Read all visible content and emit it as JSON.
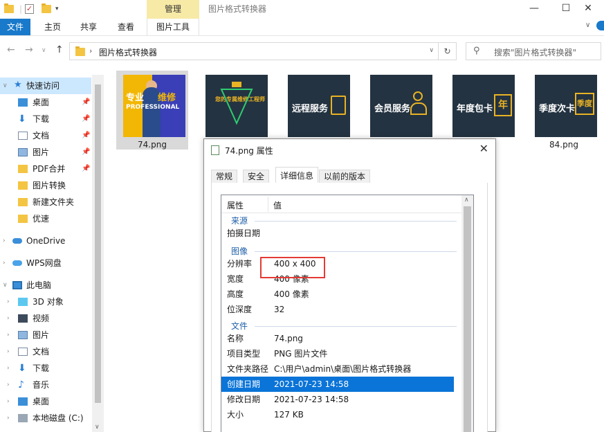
{
  "window": {
    "title": "图片格式转换器",
    "contextual_tab": "管理",
    "controls": {
      "minimize": "—",
      "maximize": "☐",
      "close": "✕"
    }
  },
  "ribbon": {
    "tabs": [
      "文件",
      "主页",
      "共享",
      "查看",
      "图片工具"
    ]
  },
  "address": {
    "path": "图片格式转换器",
    "search_placeholder": "搜索\"图片格式转换器\""
  },
  "sidebar": {
    "items": [
      {
        "label": "快速访问",
        "icon": "star-icon",
        "pinned": false
      },
      {
        "label": "桌面",
        "icon": "desktop-icon",
        "pinned": true
      },
      {
        "label": "下载",
        "icon": "download-icon",
        "pinned": true
      },
      {
        "label": "文档",
        "icon": "document-icon",
        "pinned": true
      },
      {
        "label": "图片",
        "icon": "pictures-icon",
        "pinned": true
      },
      {
        "label": "PDF合并",
        "icon": "folder-icon",
        "pinned": true
      },
      {
        "label": "图片转换",
        "icon": "folder-icon",
        "pinned": false
      },
      {
        "label": "新建文件夹",
        "icon": "folder-icon",
        "pinned": false
      },
      {
        "label": "优速",
        "icon": "folder-icon",
        "pinned": false
      },
      {
        "label": "OneDrive",
        "icon": "onedrive-icon",
        "pinned": false
      },
      {
        "label": "WPS网盘",
        "icon": "cloud-icon",
        "pinned": false
      },
      {
        "label": "此电脑",
        "icon": "computer-icon",
        "pinned": false
      },
      {
        "label": "3D 对象",
        "icon": "cube-icon",
        "pinned": false
      },
      {
        "label": "视频",
        "icon": "video-icon",
        "pinned": false
      },
      {
        "label": "图片",
        "icon": "pictures-icon",
        "pinned": false
      },
      {
        "label": "文档",
        "icon": "document-icon",
        "pinned": false
      },
      {
        "label": "下载",
        "icon": "download-icon",
        "pinned": false
      },
      {
        "label": "音乐",
        "icon": "music-icon",
        "pinned": false
      },
      {
        "label": "桌面",
        "icon": "desktop-icon",
        "pinned": false
      },
      {
        "label": "本地磁盘 (C:)",
        "icon": "disk-icon",
        "pinned": false
      }
    ]
  },
  "files": [
    {
      "name": "74.png",
      "image_text": [
        "专业",
        "维修",
        "PROFESSIONAL"
      ]
    },
    {
      "name": "",
      "image_text": [
        "您的专属维修工程师"
      ]
    },
    {
      "name": "",
      "image_text": [
        "远程服务"
      ]
    },
    {
      "name": "",
      "image_text": [
        "会员服务"
      ]
    },
    {
      "name": "",
      "image_text": [
        "年度包卡",
        "年"
      ]
    },
    {
      "name": "84.png",
      "image_text": [
        "季度次卡",
        "季度"
      ]
    }
  ],
  "dialog": {
    "title": "74.png 属性",
    "close": "✕",
    "tabs": [
      "常规",
      "安全",
      "详细信息",
      "以前的版本"
    ],
    "active_tab": "详细信息",
    "columns": [
      "属性",
      "值"
    ],
    "groups": {
      "source": "来源",
      "image": "图像",
      "file": "文件"
    },
    "rows": {
      "date_taken": {
        "k": "拍摄日期",
        "v": ""
      },
      "resolution": {
        "k": "分辨率",
        "v": "400 x 400"
      },
      "width": {
        "k": "宽度",
        "v": "400 像素"
      },
      "height": {
        "k": "高度",
        "v": "400 像素"
      },
      "bit_depth": {
        "k": "位深度",
        "v": "32"
      },
      "name": {
        "k": "名称",
        "v": "74.png"
      },
      "item_type": {
        "k": "项目类型",
        "v": "PNG 图片文件"
      },
      "folder_path": {
        "k": "文件夹路径",
        "v": "C:\\用户\\admin\\桌面\\图片格式转换器"
      },
      "created": {
        "k": "创建日期",
        "v": "2021-07-23 14:58"
      },
      "modified": {
        "k": "修改日期",
        "v": "2021-07-23 14:58"
      },
      "size": {
        "k": "大小",
        "v": "127 KB"
      }
    },
    "selected_row": "创建日期"
  },
  "colors": {
    "accent": "#1979ca",
    "manage_tab": "#f7e9a6",
    "selection": "#0a74d8",
    "highlight_box": "#e53935"
  }
}
